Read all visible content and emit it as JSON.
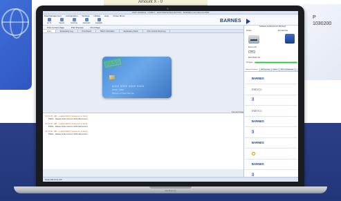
{
  "background": {
    "top_paper_text": "Amount X - 0",
    "right_card_lines": [
      "P",
      "1030200"
    ]
  },
  "laptop": {
    "brand_label": "MacBook Air"
  },
  "app": {
    "title": "CHIP HANDLE - CARD 1 - ECP PERSONALIZATION - BARNES International 2003",
    "menu": [
      "Data Management",
      "Configuration",
      "Settings",
      "Utilities",
      "Help",
      "Chase Menu"
    ],
    "ribbon_buttons": [
      "Go To",
      "Cancel",
      "Continue",
      "Automatic",
      "Available"
    ],
    "toolbar": [
      "Print Current Page",
      "Print Preview",
      "Print Page"
    ],
    "tabs": [
      "Input",
      "Explanatory Log",
      "Post Report",
      "Batch Information",
      "Explanatory Panel",
      "Print Control Panel Log"
    ],
    "active_tab_index": 0,
    "brand": "BARNES",
    "card": {
      "stamp": "PASS",
      "number": "8000 0000 0000 0000",
      "expiry": "00/00 - 0000",
      "holder": "Barnes on Card Sample"
    },
    "split_label": "Full Card Page",
    "log": [
      {
        "ts": "15:16:26 - EB - Loaded ARQC Sequence to Apply",
        "msg": "PDOL - Delete Index found in DOL/Document"
      },
      {
        "ts": "15:16:26 - EB - Loaded ARQC Sequence to Apply",
        "msg": "PDOL - Delete Index found in DOL/Document"
      },
      {
        "ts": "15:16:26 - EB - Loaded ARQC Sequence to Apply",
        "msg": "PDOL - Delete Index found in DOL/Document"
      }
    ],
    "status": "Ready  EB Active 100"
  },
  "right_panel": {
    "header": "Software Authorized for 365 days",
    "printer_label": "Printer",
    "encoder_label": "Encoder/Ver",
    "printer_id": "Barnes 001",
    "start_btn": "Start",
    "state_label": "Batch  Batch 001",
    "progress_label": "Progress",
    "progress": 1.0,
    "tabs": [
      "Selected Products",
      "All Card Log",
      "Status",
      "EPS / Qualification"
    ],
    "active_tab_index": 0,
    "items": [
      {
        "kind": "barnes",
        "label": "BARNES"
      },
      {
        "kind": "ebmc",
        "label": "EMVCo"
      },
      {
        "kind": "wave",
        "label": "))"
      },
      {
        "kind": "ebmc",
        "label": "EMVCo"
      },
      {
        "kind": "barnes",
        "label": "BARNES"
      },
      {
        "kind": "wave",
        "label": "))"
      },
      {
        "kind": "barnes",
        "label": "BARNES"
      },
      {
        "kind": "ring",
        "label": ""
      },
      {
        "kind": "barnes",
        "label": "BARNES"
      },
      {
        "kind": "wave",
        "label": "))"
      }
    ]
  },
  "colors": {
    "brand": "#1d3f8a",
    "pass": "#3fbf46",
    "progress": "#2fbf45",
    "background_band": "#2b3f86"
  }
}
